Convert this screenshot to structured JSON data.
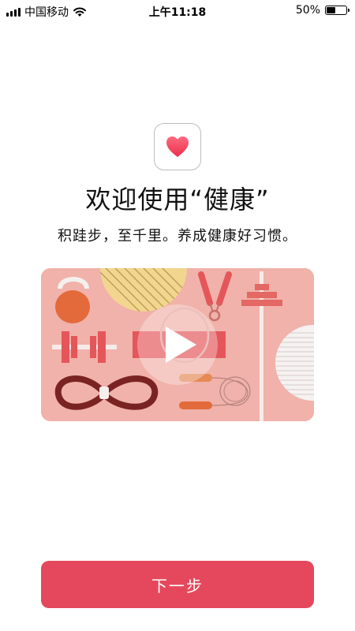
{
  "status_bar": {
    "carrier": "中国移动",
    "time": "上午11:18",
    "battery_percent": "50%",
    "battery_level": 0.5,
    "signal_bars": 4
  },
  "app_icon": {
    "icon": "heart-icon",
    "color": "#f0485e"
  },
  "title": "欢迎使用“健康”",
  "subtitle": "积跬步，至千里。养成健康好习惯。",
  "video": {
    "play_icon": "play-icon",
    "background_color": "#f0b2aa",
    "items": [
      "kettlebell-icon",
      "dumbbell-icon",
      "resistance-band-icon",
      "yoga-ball-icon",
      "hand-grip-icon",
      "ring-stack-icon",
      "jump-rope-icon",
      "exercise-ball-icon"
    ]
  },
  "next_button": {
    "label": "下一步",
    "color": "#e5485c"
  }
}
